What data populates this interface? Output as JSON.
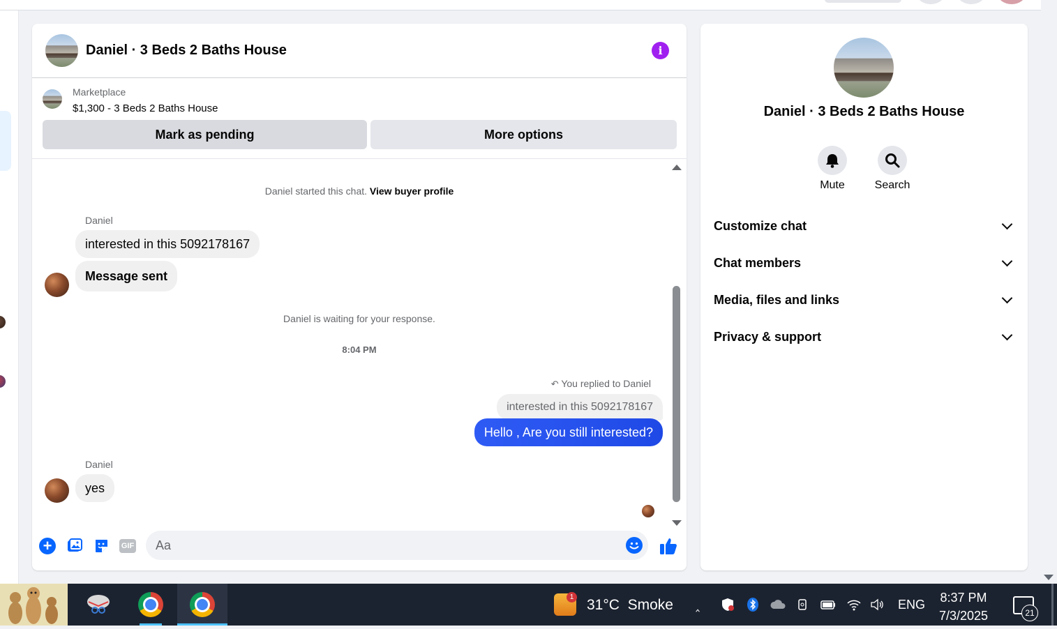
{
  "conversation": {
    "title": "Daniel · 3 Beds 2 Baths House",
    "listing": {
      "source": "Marketplace",
      "summary": "$1,300 - 3 Beds 2 Baths House",
      "primary_action": "Mark as pending",
      "secondary_action": "More options"
    },
    "messages": {
      "started_text": "Daniel started this chat.",
      "view_profile_link": "View buyer profile",
      "sender_name_1": "Daniel",
      "incoming_1": "interested in this 5092178167",
      "incoming_2": "Message sent",
      "waiting_text": "Daniel is waiting for your response.",
      "timestamp": "8:04 PM",
      "replied_label": "You replied to Daniel",
      "quoted_text": "interested in this 5092178167",
      "outgoing_1": "Hello , Are you still interested?",
      "sender_name_2": "Daniel",
      "incoming_3": "yes"
    },
    "composer": {
      "placeholder": "Aa",
      "gif_label": "GIF",
      "add_label": "+"
    }
  },
  "side_panel": {
    "name": "Daniel · 3 Beds 2 Baths House",
    "actions": [
      {
        "label": "Mute",
        "icon": "bell-icon"
      },
      {
        "label": "Search",
        "icon": "search-icon"
      }
    ],
    "sections": [
      {
        "label": "Customize chat"
      },
      {
        "label": "Chat members"
      },
      {
        "label": "Media, files and links"
      },
      {
        "label": "Privacy & support"
      }
    ]
  },
  "taskbar": {
    "weather_temp": "31°C",
    "weather_desc": "Smoke",
    "weather_badge": "1",
    "language": "ENG",
    "time": "8:37 PM",
    "date": "7/3/2025",
    "notification_count": "21"
  },
  "colors": {
    "accent_blue": "#0866ff",
    "outgoing_bubble": "#2f5bf5",
    "info_purple": "#a020f0",
    "taskbar_bg": "#1c2330"
  }
}
